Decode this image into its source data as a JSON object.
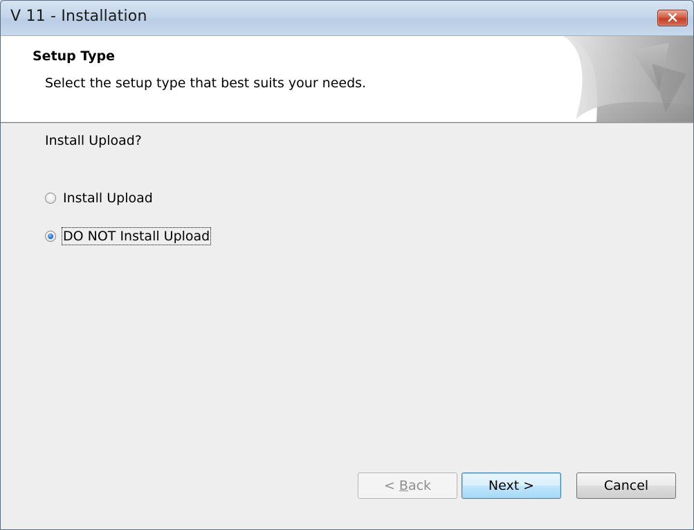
{
  "window": {
    "title": "V 11 - Installation"
  },
  "header": {
    "title": "Setup Type",
    "subtitle": "Select the setup type that best suits your needs."
  },
  "content": {
    "question": "Install Upload?",
    "options": [
      {
        "label": "Install Upload",
        "selected": false
      },
      {
        "label": "DO NOT Install Upload",
        "selected": true
      }
    ]
  },
  "buttons": {
    "back_prefix": "< ",
    "back_accel": "B",
    "back_rest": "ack",
    "back_enabled": false,
    "next": "Next >",
    "cancel": "Cancel"
  },
  "icons": {
    "close": "close-x-icon",
    "header_graphic": "page-curl-graphic"
  },
  "colors": {
    "titlebar": "#c4d6ea",
    "close_button": "#c3402a",
    "default_button_border": "#3c7fb1",
    "radio_checked": "#2a74d0"
  }
}
